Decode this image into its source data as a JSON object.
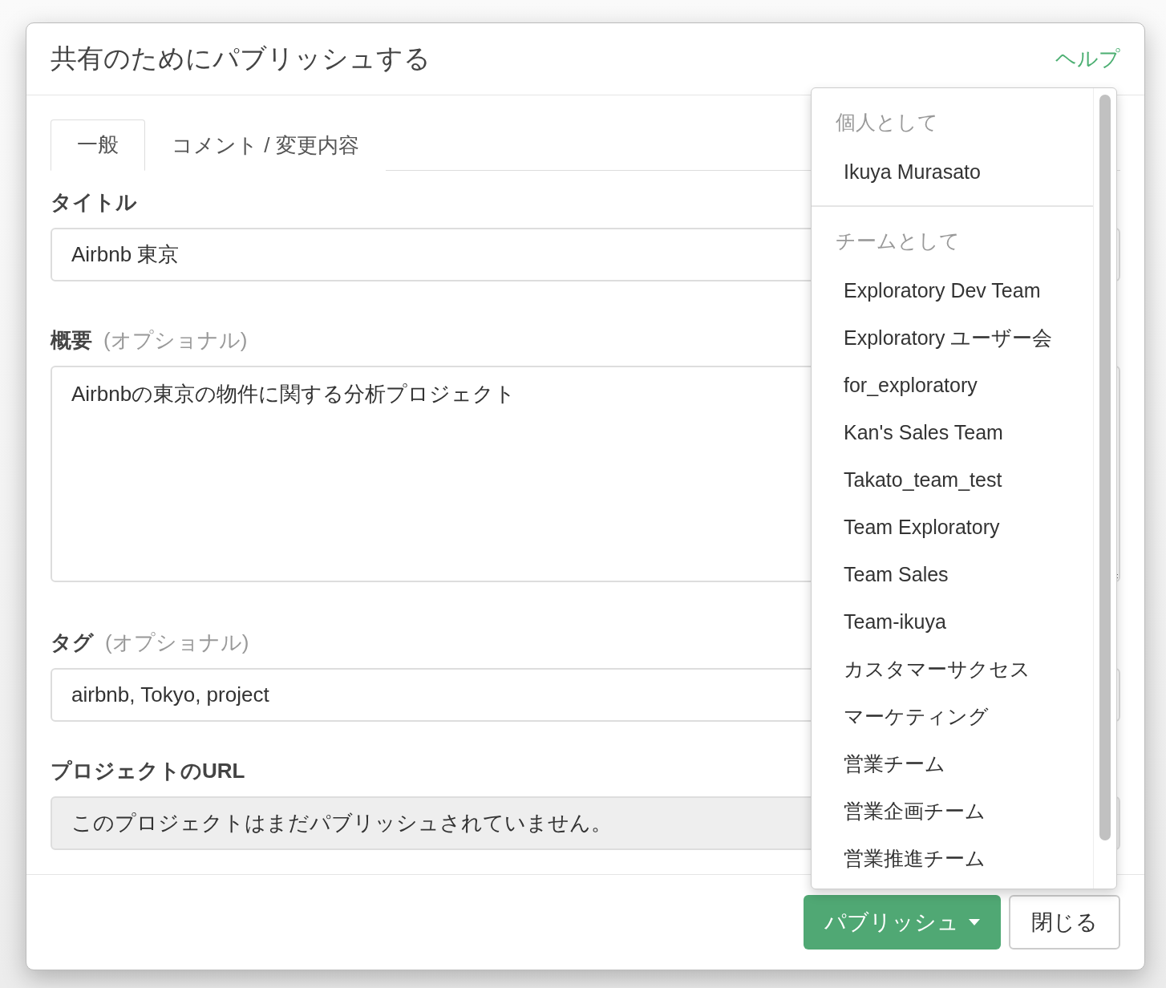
{
  "dialog": {
    "title": "共有のためにパブリッシュする",
    "help_link": "ヘルプ"
  },
  "tabs": [
    {
      "label": "一般",
      "selected": true
    },
    {
      "label": "コメント / 変更内容",
      "selected": false
    }
  ],
  "form": {
    "title": {
      "label": "タイトル",
      "value": "Airbnb 東京"
    },
    "summary": {
      "label": "概要",
      "optional": "(オプショナル)",
      "value": "Airbnbの東京の物件に関する分析プロジェクト"
    },
    "tags": {
      "label": "タグ",
      "optional": "(オプショナル)",
      "value": "airbnb, Tokyo, project"
    },
    "url": {
      "label": "プロジェクトのURL",
      "value": "このプロジェクトはまだパブリッシュされていません。"
    }
  },
  "publish_menu": {
    "sections": [
      {
        "header": "個人として",
        "items": [
          "Ikuya Murasato"
        ]
      },
      {
        "header": "チームとして",
        "items": [
          "Exploratory Dev Team",
          "Exploratory ユーザー会",
          "for_exploratory",
          "Kan's Sales Team",
          "Takato_team_test",
          "Team Exploratory",
          "Team Sales",
          "Team-ikuya",
          "カスタマーサクセス",
          "マーケティング",
          "営業チーム",
          "営業企画チーム",
          "営業推進チーム"
        ]
      }
    ]
  },
  "buttons": {
    "publish": "パブリッシュ",
    "close": "閉じる"
  }
}
